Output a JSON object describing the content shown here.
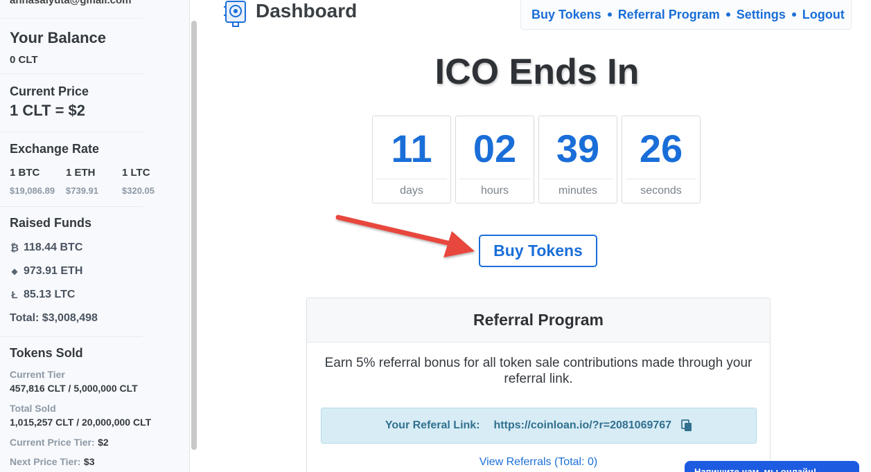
{
  "user": {
    "email": "annasalyuta@gmail.com"
  },
  "balance": {
    "title": "Your Balance",
    "value": "0 CLT"
  },
  "price": {
    "title": "Current Price",
    "value": "1 CLT = $2"
  },
  "exchange": {
    "title": "Exchange Rate",
    "rates": [
      {
        "unit": "1 BTC",
        "usd": "$19,086.89"
      },
      {
        "unit": "1 ETH",
        "usd": "$739.91"
      },
      {
        "unit": "1 LTC",
        "usd": "$320.05"
      }
    ]
  },
  "raised": {
    "title": "Raised Funds",
    "items": [
      {
        "icon": "bitcoin-icon",
        "symbol": "₿",
        "value": "118.44 BTC"
      },
      {
        "icon": "ethereum-icon",
        "symbol": "◆",
        "value": "973.91 ETH"
      },
      {
        "icon": "litecoin-icon",
        "symbol": "Ł",
        "value": "85.13 LTC"
      }
    ],
    "total": "Total: $3,008,498"
  },
  "tokens": {
    "title": "Tokens Sold",
    "current_tier_label": "Current Tier",
    "current_tier_value": "457,816 CLT / 5,000,000 CLT",
    "total_sold_label": "Total Sold",
    "total_sold_value": "1,015,257 CLT / 20,000,000 CLT",
    "current_price_tier_label": "Current Price Tier:",
    "current_price_tier_value": "$2",
    "next_price_tier_label": "Next Price Tier:",
    "next_price_tier_value": "$3"
  },
  "header": {
    "title": "Dashboard",
    "nav": [
      "Buy Tokens",
      "Referral Program",
      "Settings",
      "Logout"
    ]
  },
  "countdown": {
    "title": "ICO Ends In",
    "units": [
      {
        "value": "11",
        "label": "days"
      },
      {
        "value": "02",
        "label": "hours"
      },
      {
        "value": "39",
        "label": "minutes"
      },
      {
        "value": "26",
        "label": "seconds"
      }
    ]
  },
  "buy_button": "Buy Tokens",
  "referral": {
    "title": "Referral Program",
    "description": "Earn 5% referral bonus for all token sale contributions made through your referral link.",
    "link_label": "Your Referal Link:",
    "link": "https://coinloan.io/?r=2081069767",
    "view_link": "View Referrals (Total: 0)"
  },
  "chat": {
    "text": "Напишите нам, мы онлайн!"
  },
  "colors": {
    "accent": "#1a6ed8",
    "arrow": "#e8473c",
    "info_bg": "#d7ecf5"
  }
}
